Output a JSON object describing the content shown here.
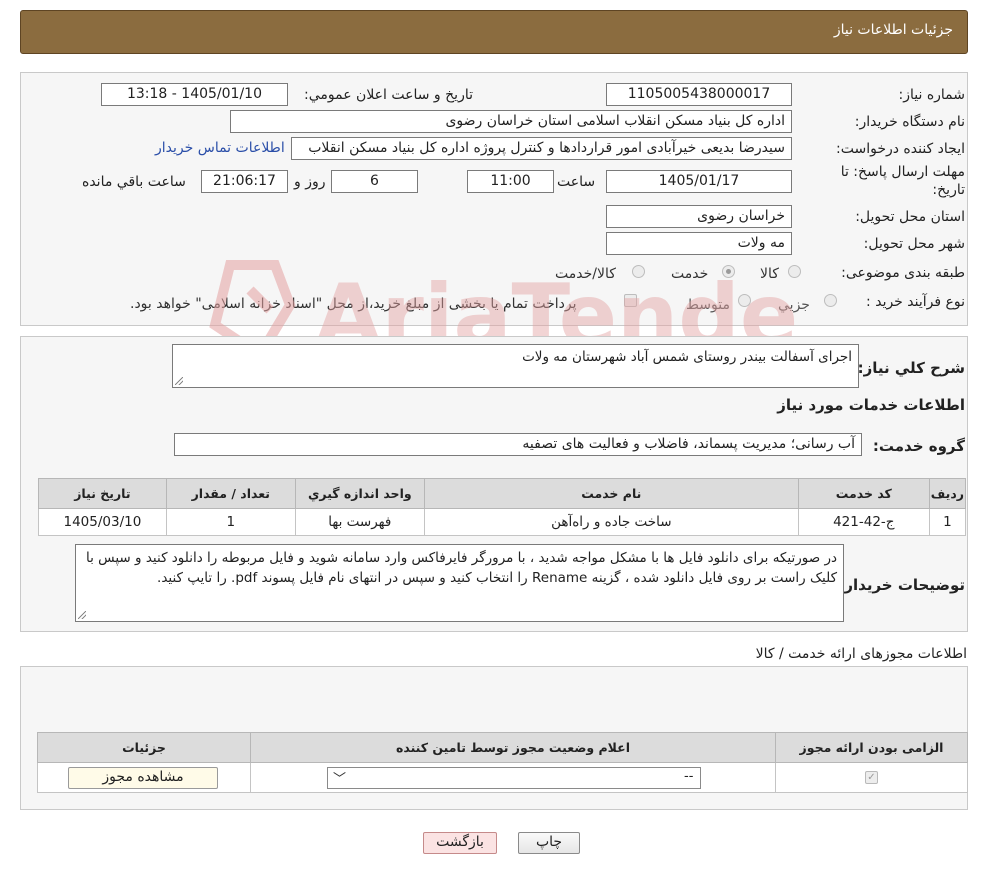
{
  "header": {
    "title": "جزئیات اطلاعات نیاز"
  },
  "form": {
    "need_number_label": "شماره نیاز:",
    "need_number": "1105005438000017",
    "announce_label": "تاریخ و ساعت اعلان عمومي:",
    "announce_value": "1405/01/10 - 13:18",
    "buyer_org_label": "نام دستگاه خريدار:",
    "buyer_org": "اداره کل بنیاد مسکن انقلاب اسلامی استان خراسان رضوی",
    "requester_label": "ايجاد کننده درخواست:",
    "requester": "سیدرضا بدیعی خیرآبادی امور قراردادها و کنترل پروژه اداره کل بنیاد مسکن انقلاب",
    "contact_link": "اطلاعات تماس خريدار",
    "deadline_label": "مهلت ارسال پاسخ: تا تاریخ:",
    "deadline_date": "1405/01/17",
    "time_label": "ساعت",
    "deadline_time": "11:00",
    "days_value": "6",
    "days_label": "روز و",
    "remaining_time": "21:06:17",
    "remaining_label": "ساعت باقي مانده",
    "province_label": "استان محل تحويل:",
    "province": "خراسان رضوی",
    "city_label": "شهر محل تحويل:",
    "city": "مه ولات",
    "category_label": "طبقه بندی موضوعی:",
    "category_options": [
      "کالا",
      "خدمت",
      "کالا/خدمت"
    ],
    "process_label": "نوع فرآيند خريد :",
    "process_options": [
      "جزیي",
      "متوسط"
    ],
    "process_note": "پرداخت تمام یا بخشی از مبلغ خرید،از محل \"اسناد خزانه اسلامی\" خواهد بود."
  },
  "details": {
    "summary_label": "شرح کلي نياز:",
    "summary": "اجرای آسفالت بیندر روستای شمس آباد شهرستان مه ولات",
    "services_title": "اطلاعات خدمات مورد نياز",
    "group_label": "گروه خدمت:",
    "group_value": "آب رسانی؛ مدیریت پسماند، فاضلاب و فعالیت های تصفیه",
    "table_headers": [
      "رديف",
      "کد خدمت",
      "نام خدمت",
      "واحد اندازه گيري",
      "تعداد / مقدار",
      "تاريخ نياز"
    ],
    "table_rows": [
      [
        "1",
        "ج-42-421",
        "ساخت جاده و راه‌آهن",
        "فهرست بها",
        "1",
        "1405/03/10"
      ]
    ],
    "buyer_notes_label": "توضيحات خريدار:",
    "buyer_notes": "در صورتیکه برای دانلود فایل ها با مشکل مواجه شدید ، با مرورگر فایرفاکس وارد سامانه شوید و فایل مربوطه را دانلود کنید و سپس با کلیک راست بر روی فایل دانلود شده ، گزینه Rename را انتخاب کنید و سپس در انتهای نام فایل پسوند pdf. را تایپ کنید."
  },
  "permits": {
    "title": "اطلاعات مجوزهای ارائه خدمت / کالا",
    "headers": [
      "الزامی بودن ارائه مجوز",
      "اعلام وضعیت مجوز توسط تامین کننده",
      "جزئیات"
    ],
    "select_value": "--",
    "view_button": "مشاهده مجوز"
  },
  "footer": {
    "print_button": "چاپ",
    "back_button": "بازگشت"
  },
  "watermark": {
    "text": "AriaTender.neT"
  },
  "colors": {
    "header_bg": "#8b6c3f",
    "link": "#2a4ea8",
    "watermark": "#e4a1a1"
  }
}
